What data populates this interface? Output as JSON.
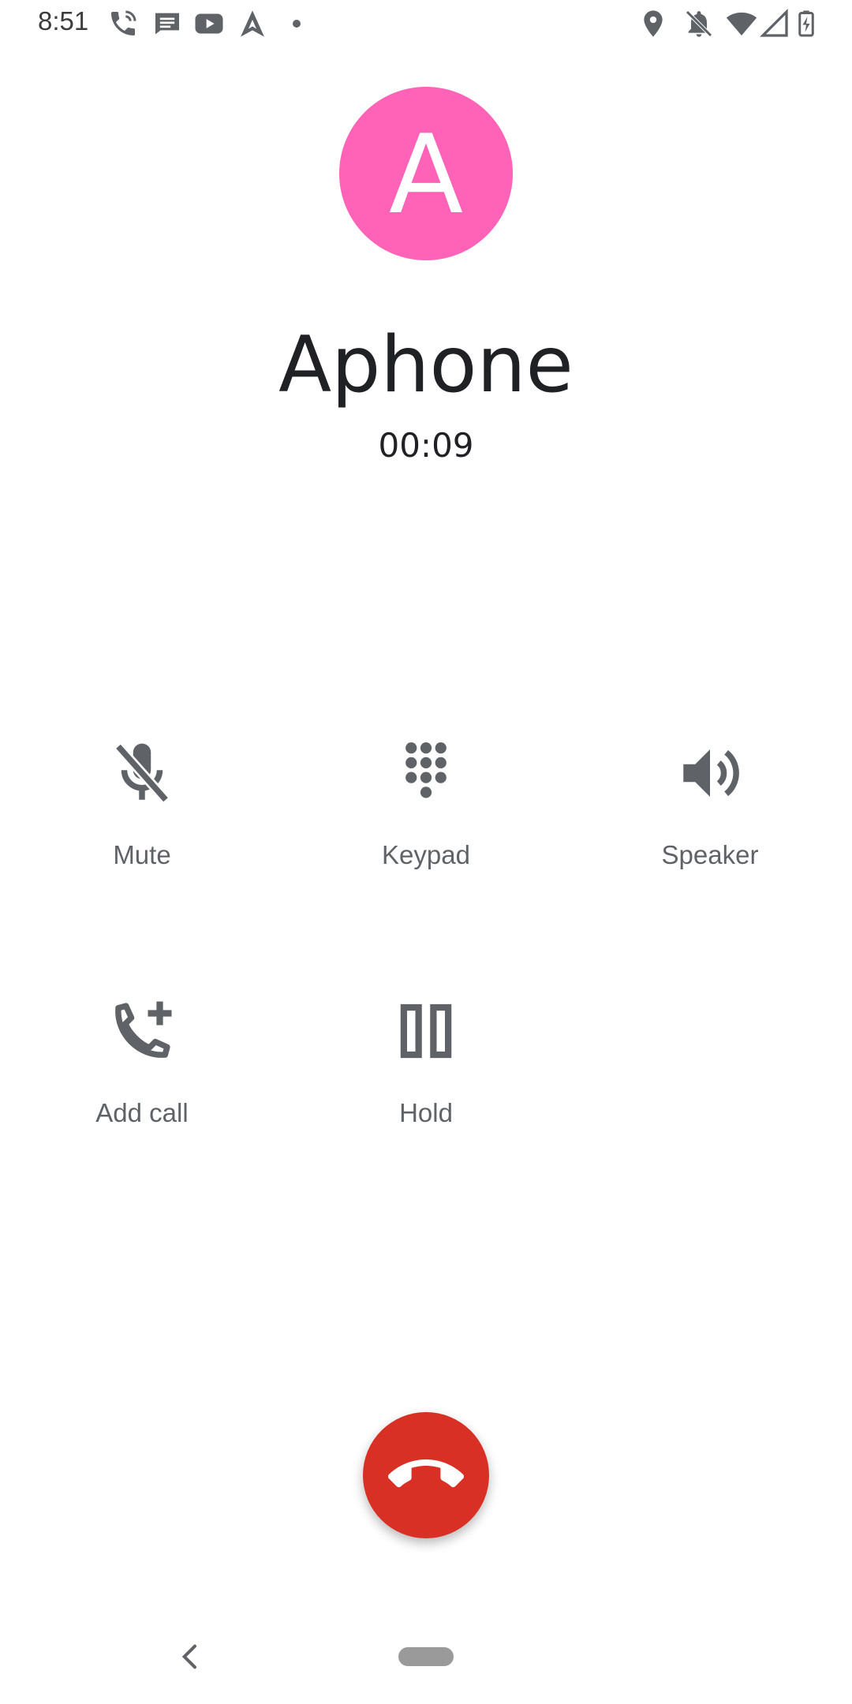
{
  "status_bar": {
    "time": "8:51",
    "icons": [
      "phone-call-icon",
      "message-icon",
      "youtube-icon",
      "navigation-arrow-icon",
      "dot-icon",
      "location-icon",
      "notifications-off-icon",
      "wifi-icon",
      "signal-icon",
      "battery-charging-icon"
    ]
  },
  "caller": {
    "initial": "A",
    "name": "Aphone",
    "duration": "00:09",
    "avatar_color": "#ff63b8"
  },
  "controls": {
    "mute_label": "Mute",
    "keypad_label": "Keypad",
    "speaker_label": "Speaker",
    "add_call_label": "Add call",
    "hold_label": "Hold"
  },
  "end_call": {
    "icon": "end-call-icon",
    "color": "#d93025"
  },
  "nav_bar": {
    "back_icon": "back-chevron-icon",
    "home_icon": "home-pill-icon"
  },
  "colors": {
    "icon": "#5f6368",
    "text": "#202124"
  }
}
